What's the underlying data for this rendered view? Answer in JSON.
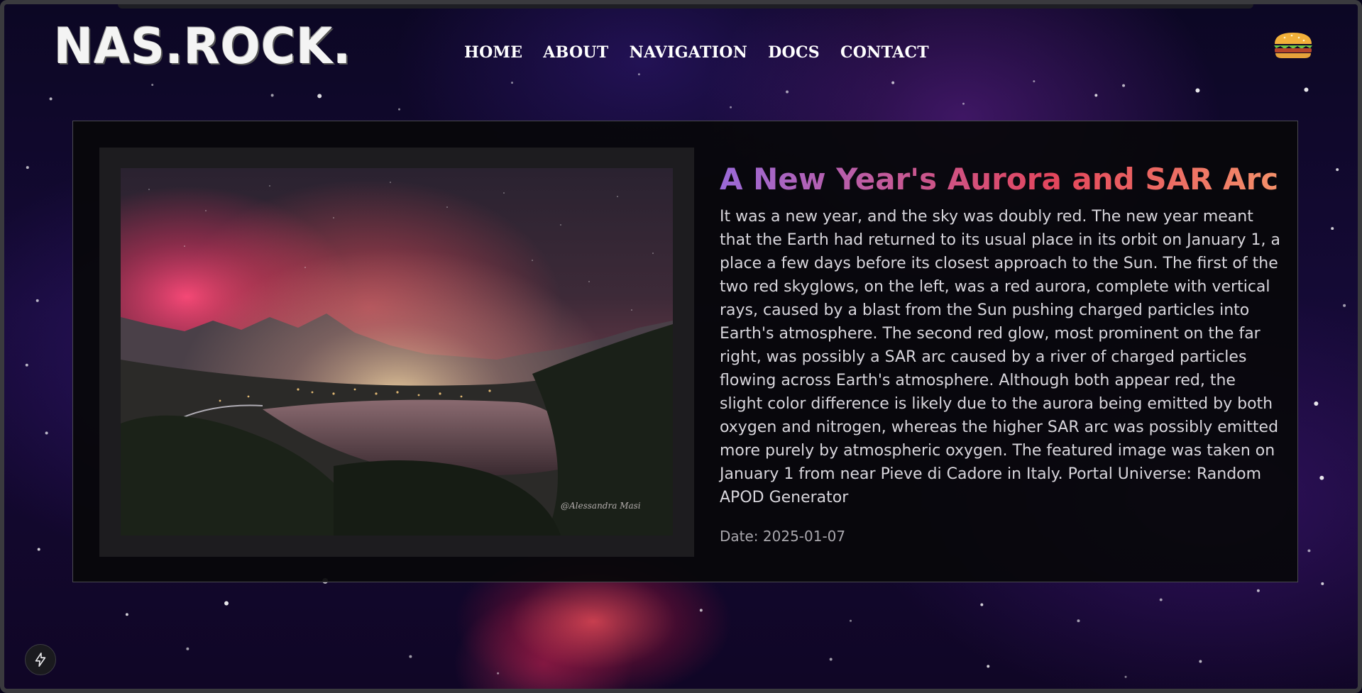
{
  "brand": {
    "logo_text": "NAS.ROCK."
  },
  "nav": {
    "items": [
      {
        "label": "HOME"
      },
      {
        "label": "ABOUT"
      },
      {
        "label": "NAVIGATION"
      },
      {
        "label": "DOCS"
      },
      {
        "label": "CONTACT"
      }
    ]
  },
  "menu": {
    "icon": "hamburger-menu-icon"
  },
  "apod": {
    "title": "A New Year's Aurora and SAR Arc",
    "explanation": "It was a new year, and the sky was doubly red. The new year meant that the Earth had returned to its usual place in its orbit on January 1, a place a few days before its closest approach to the Sun. The first of the two red skyglows, on the left, was a red aurora, complete with vertical rays, caused by a blast from the Sun pushing charged particles into Earth's atmosphere. The second red glow, most prominent on the far right, was possibly a SAR arc caused by a river of charged particles flowing across Earth's atmosphere. Although both appear red, the slight color difference is likely due to the aurora being emitted by both oxygen and nitrogen, whereas the higher SAR arc was possibly emitted more purely by atmospheric oxygen. The featured image was taken on January 1 from near Pieve di Cadore in Italy. Portal Universe: Random APOD Generator",
    "date_text": "Date: 2025-01-07",
    "image_credit": "@Alessandra Masi"
  },
  "floating": {
    "icon": "lightning-bolt-icon"
  },
  "colors": {
    "title_gradient": [
      "#9a6ad8",
      "#e4465c",
      "#f4906a"
    ],
    "card_bg": "#08070a",
    "text": "#d8d6dc"
  }
}
